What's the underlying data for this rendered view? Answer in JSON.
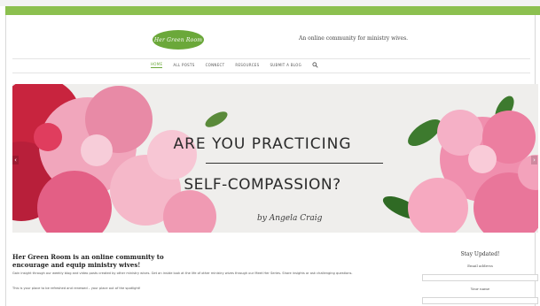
{
  "site": {
    "logo_text": "Her Green Room",
    "tagline": "An online community for ministry wives."
  },
  "nav": {
    "items": [
      {
        "label": "HOME",
        "active": true
      },
      {
        "label": "ALL POSTS",
        "active": false
      },
      {
        "label": "CONNECT",
        "active": false
      },
      {
        "label": "RESOURCES",
        "active": false
      },
      {
        "label": "SUBMIT A BLOG",
        "active": false
      }
    ],
    "search_icon": "search-icon"
  },
  "banner": {
    "line1": "ARE YOU PRACTICING",
    "line2": "SELF-COMPASSION?",
    "byline": "by Angela Craig",
    "prev_icon": "chevron-left-icon",
    "next_icon": "chevron-right-icon"
  },
  "intro": {
    "title": "Her Green Room is an online community to encourage and equip ministry wives!",
    "body": "Gain insight through our weekly blog and video posts created by other ministry wives. Get an inside look at the life of other ministry wives through our Meet Her Series. Share insights or ask challenging questions.",
    "note": "This is your place to be refreshed and renewed – your place out of the spotlight!"
  },
  "sidebar": {
    "title": "Stay Updated!",
    "email_label": "Email address",
    "name_label": "Your name"
  },
  "colors": {
    "brand_green": "#6ba83a",
    "top_bar": "#8cc04f"
  }
}
